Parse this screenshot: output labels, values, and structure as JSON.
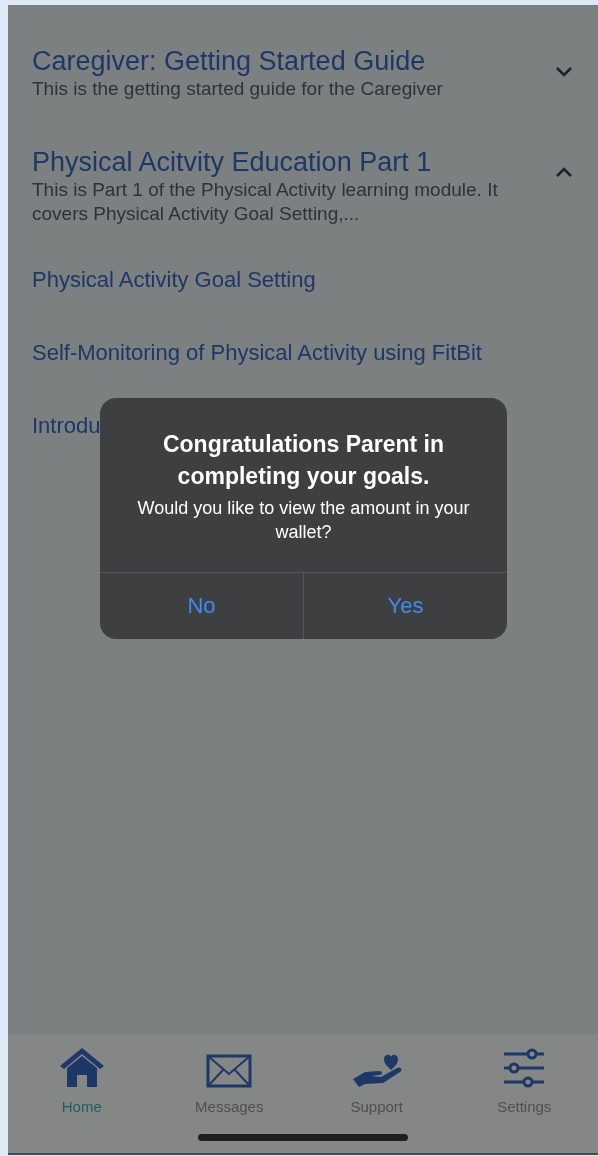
{
  "modules": [
    {
      "title": "Caregiver: Getting Started Guide",
      "description": "This is the getting started guide for the Caregiver",
      "expanded": false
    },
    {
      "title": "Physical Acitvity Education Part 1",
      "description": "This is Part 1 of the Physical Activity learning module. It covers Physical Activity Goal Setting,...",
      "expanded": true,
      "lessons": [
        "Physical Activity Goal Setting",
        "Self-Monitoring of Physical Activity using FitBit",
        "Introdu"
      ]
    }
  ],
  "dialog": {
    "title": "Congratulations Parent in completing your goals.",
    "message": "Would you like to view the amount in your wallet?",
    "buttons": [
      "No",
      "Yes"
    ]
  },
  "tab_bar": [
    {
      "kind": "home",
      "label": "Home",
      "selected": true
    },
    {
      "kind": "messages",
      "label": "Messages",
      "selected": false
    },
    {
      "kind": "support",
      "label": "Support",
      "selected": false
    },
    {
      "kind": "settings",
      "label": "Settings",
      "selected": false
    }
  ]
}
